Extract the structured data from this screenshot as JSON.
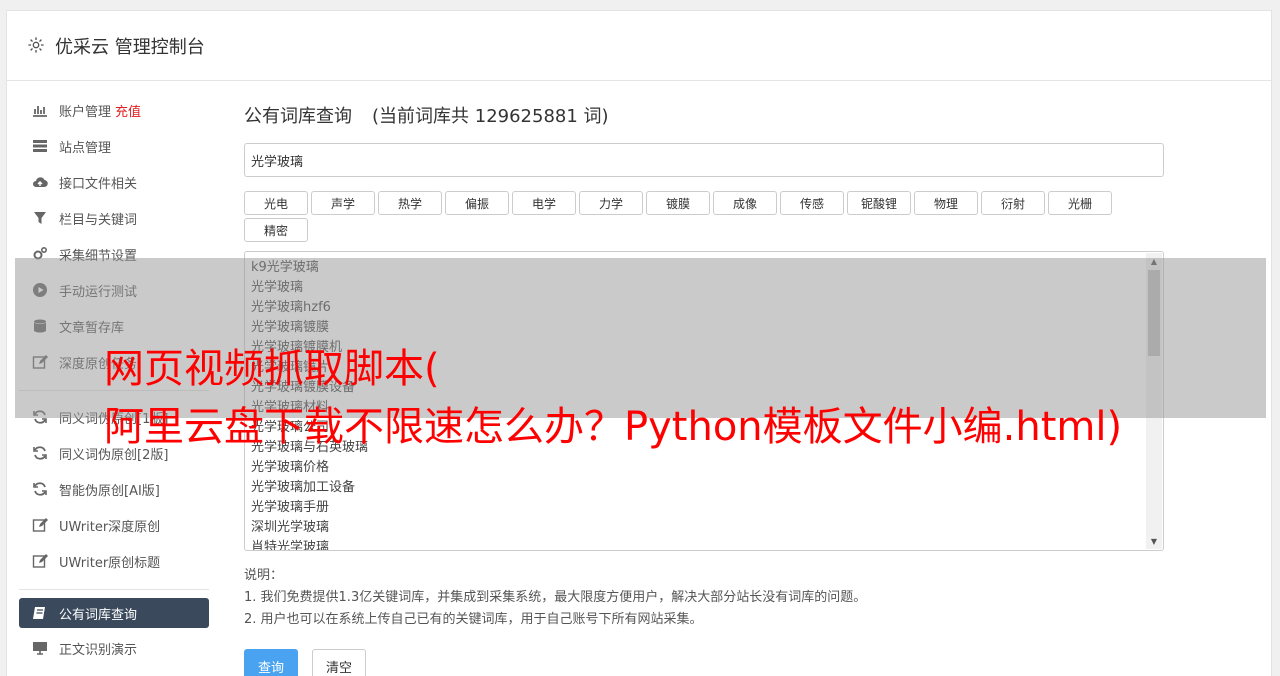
{
  "header": {
    "title": "优采云 管理控制台",
    "icon": "gear-icon"
  },
  "sidebar": {
    "items": [
      {
        "label": "账户管理",
        "extra": "充值",
        "icon": "bar-chart-icon"
      },
      {
        "label": "站点管理",
        "icon": "server-icon"
      },
      {
        "label": "接口文件相关",
        "icon": "cloud-upload-icon"
      },
      {
        "label": "栏目与关键词",
        "icon": "filter-icon"
      },
      {
        "label": "采集细节设置",
        "icon": "gears-icon"
      },
      {
        "label": "手动运行测试",
        "icon": "play-circle-icon"
      },
      {
        "label": "文章暂存库",
        "icon": "database-icon"
      },
      {
        "label": "深度原创任务",
        "icon": "edit-icon"
      },
      {
        "label": "同义词伪原创[1版]",
        "icon": "refresh-icon"
      },
      {
        "label": "同义词伪原创[2版]",
        "icon": "refresh-icon"
      },
      {
        "label": "智能伪原创[AI版]",
        "icon": "refresh-icon"
      },
      {
        "label": "UWriter深度原创",
        "icon": "edit-icon"
      },
      {
        "label": "UWriter原创标题",
        "icon": "edit-icon"
      },
      {
        "label": "公有词库查询",
        "icon": "book-icon",
        "active": true
      },
      {
        "label": "正文识别演示",
        "icon": "monitor-icon"
      }
    ]
  },
  "main": {
    "title": "公有词库查询",
    "count_text": "(当前词库共 129625881 词)",
    "search_value": "光学玻璃",
    "tags": [
      "光电",
      "声学",
      "热学",
      "偏振",
      "电学",
      "力学",
      "镀膜",
      "成像",
      "传感",
      "铌酸锂",
      "物理",
      "衍射",
      "光栅",
      "精密"
    ],
    "results": [
      "k9光学玻璃",
      "光学玻璃",
      "光学玻璃hzf6",
      "光学玻璃镀膜",
      "光学玻璃镀膜机",
      "光学玻璃镜片",
      "光学玻璃镀膜设备",
      "光学玻璃材料",
      "光学玻璃公司",
      "光学玻璃与石英玻璃",
      "光学玻璃价格",
      "光学玻璃加工设备",
      "光学玻璃手册",
      "深圳光学玻璃",
      "肖特光学玻璃"
    ],
    "notes_title": "说明：",
    "notes": [
      "1. 我们免费提供1.3亿关键词库，并集成到采集系统，最大限度方便用户，解决大部分站长没有词库的问题。",
      "2. 用户也可以在系统上传自己已有的关键词库，用于自己账号下所有网站采集。"
    ],
    "query_button": "查询",
    "clear_button": "清空"
  },
  "overlay": {
    "line1": "网页视频抓取脚本(",
    "line2": "阿里云盘下载不限速怎么办？Python模板文件小编.html)"
  }
}
